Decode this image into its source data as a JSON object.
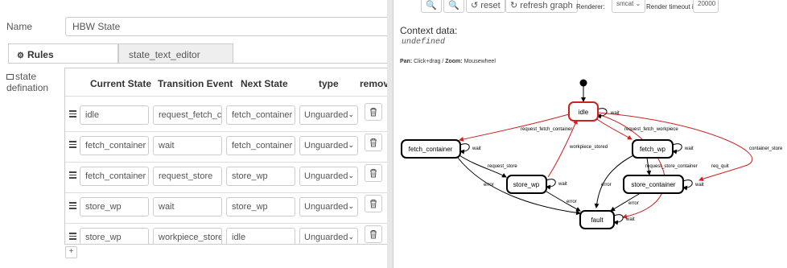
{
  "form": {
    "name_label": "Name",
    "name_value": "HBW State",
    "tabs": [
      {
        "label": "Rules",
        "active": true
      },
      {
        "label": "state_text_editor",
        "active": false
      }
    ],
    "state_definition_label": "state\ndefination",
    "add_icon": "plus-icon"
  },
  "table": {
    "headers": [
      "Current State",
      "Transition Event",
      "Next State",
      "type",
      "remove"
    ],
    "rows": [
      {
        "current": "idle",
        "event": "request_fetch_container",
        "next": "fetch_container",
        "type": "Unguarded"
      },
      {
        "current": "fetch_container",
        "event": "wait",
        "next": "fetch_container",
        "type": "Unguarded"
      },
      {
        "current": "fetch_container",
        "event": "request_store",
        "next": "store_wp",
        "type": "Unguarded"
      },
      {
        "current": "store_wp",
        "event": "wait",
        "next": "store_wp",
        "type": "Unguarded"
      },
      {
        "current": "store_wp",
        "event": "workpiece_stored",
        "next": "idle",
        "type": "Unguarded"
      }
    ]
  },
  "toolbar": {
    "reset_label": "reset",
    "refresh_label": "refresh graph",
    "renderer_label": "Renderer:",
    "renderer_value": "smcat",
    "timeout_label": "Render timeout in ms:",
    "timeout_value": "20000"
  },
  "context": {
    "title": "Context data:",
    "value": "undefined",
    "pan_label": "Pan:",
    "pan_text": "Click+drag / ",
    "zoom_label": "Zoom:",
    "zoom_text": "Mousewheel"
  },
  "diagram": {
    "states": [
      "idle",
      "fetch_container",
      "fetch_wp",
      "store_wp",
      "store_container",
      "fault"
    ],
    "edge_labels": [
      "wait",
      "request_fetch_container",
      "request_fetch_workpiece",
      "workpiece_stored",
      "container_store",
      "request_store",
      "request_store_container",
      "req_quit",
      "error"
    ],
    "colors": {
      "active": "#cc2222",
      "normal": "#000000"
    }
  }
}
